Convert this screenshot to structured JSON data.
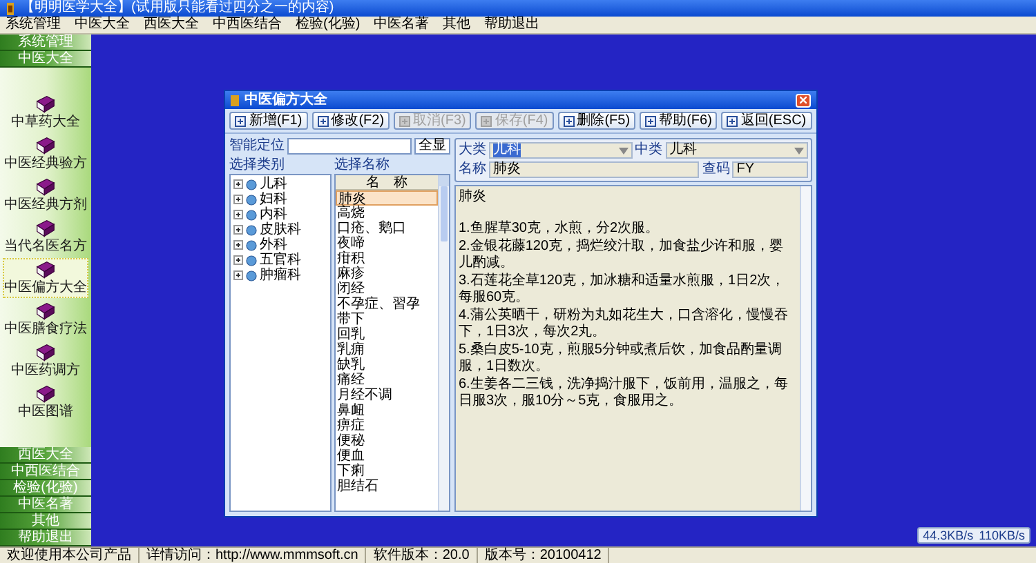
{
  "window": {
    "title": "【明明医学大全】(试用版只能看过四分之一的内容)"
  },
  "menu": [
    "系统管理",
    "中医大全",
    "西医大全",
    "中西医结合",
    "检验(化验)",
    "中医名著",
    "其他",
    "帮助退出"
  ],
  "sidebar": {
    "top_sections": [
      "系统管理",
      "中医大全"
    ],
    "items": [
      {
        "label": "中草药大全",
        "selected": false
      },
      {
        "label": "中医经典验方",
        "selected": false
      },
      {
        "label": "中医经典方剂",
        "selected": false
      },
      {
        "label": "当代名医名方",
        "selected": false
      },
      {
        "label": "中医偏方大全",
        "selected": true
      },
      {
        "label": "中医膳食疗法",
        "selected": false
      },
      {
        "label": "中医药调方",
        "selected": false
      },
      {
        "label": "中医图谱",
        "selected": false
      }
    ],
    "bottom_sections": [
      "西医大全",
      "中西医结合",
      "检验(化验)",
      "中医名著",
      "其他",
      "帮助退出"
    ]
  },
  "dialog": {
    "title": "中医偏方大全",
    "toolbar": [
      {
        "label": "新增(F1)",
        "disabled": false
      },
      {
        "label": "修改(F2)",
        "disabled": false
      },
      {
        "label": "取消(F3)",
        "disabled": true
      },
      {
        "label": "保存(F4)",
        "disabled": true
      },
      {
        "label": "删除(F5)",
        "disabled": false
      },
      {
        "label": "帮助(F6)",
        "disabled": false
      },
      {
        "label": "返回(ESC)",
        "disabled": false
      }
    ],
    "search_label": "智能定位",
    "show_all_button": "全显",
    "categories": {
      "heading": "选择类别",
      "items": [
        {
          "label": "儿科",
          "expanded": false
        },
        {
          "label": "妇科",
          "expanded": false
        },
        {
          "label": "内科",
          "expanded": false
        },
        {
          "label": "皮肤科",
          "expanded": false
        },
        {
          "label": "外科",
          "expanded": false
        },
        {
          "label": "五官科",
          "expanded": false
        },
        {
          "label": "肿瘤科",
          "expanded": false
        }
      ]
    },
    "names": {
      "heading": "选择名称",
      "column": "名　称",
      "items": [
        {
          "label": "肺炎",
          "selected": true
        },
        {
          "label": "高烧",
          "selected": false
        },
        {
          "label": "口疮、鹅口",
          "selected": false
        },
        {
          "label": "夜啼",
          "selected": false
        },
        {
          "label": "疳积",
          "selected": false
        },
        {
          "label": "麻疹",
          "selected": false
        },
        {
          "label": "闭经",
          "selected": false
        },
        {
          "label": "不孕症、習孕",
          "selected": false
        },
        {
          "label": "带下",
          "selected": false
        },
        {
          "label": "回乳",
          "selected": false
        },
        {
          "label": "乳痈",
          "selected": false
        },
        {
          "label": "缺乳",
          "selected": false
        },
        {
          "label": "痛经",
          "selected": false
        },
        {
          "label": "月经不调",
          "selected": false
        },
        {
          "label": "鼻衄",
          "selected": false
        },
        {
          "label": "痹症",
          "selected": false
        },
        {
          "label": "便秘",
          "selected": false
        },
        {
          "label": "便血",
          "selected": false
        },
        {
          "label": "下痢",
          "selected": false
        },
        {
          "label": "胆结石",
          "selected": false
        }
      ]
    },
    "form": {
      "major_label": "大类",
      "major_value": "儿科",
      "middle_label": "中类",
      "middle_value": "儿科",
      "name_label": "名称",
      "name_value": "肺炎",
      "code_label": "查码",
      "code_value": "FY"
    },
    "content": {
      "heading": "肺炎",
      "lines": [
        "1.鱼腥草30克，水煎，分2次服。",
        "2.金银花藤120克，捣烂绞汁取，加食盐少许和服，婴儿酌减。",
        "3.石莲花全草120克，加冰糖和适量水煎服，1日2次，每服60克。",
        "4.蒲公英晒干，研粉为丸如花生大，口含溶化，慢慢吞下，1日3次，每次2丸。",
        "5.桑白皮5-10克，煎服5分钟或煮后饮，加食品酌量调服，1日数次。",
        "6.生姜各二三钱，洗净捣汁服下，饭前用，温服之，每日服3次，服10分～5克，食服用之。"
      ]
    }
  },
  "status_bar": [
    "欢迎使用本公司产品",
    "详情访问：http://www.mmmsoft.cn",
    "软件版本：20.0",
    "版本号：20100412"
  ],
  "net_speed": {
    "down": "44.3KB/s",
    "up": "110KB/s"
  }
}
